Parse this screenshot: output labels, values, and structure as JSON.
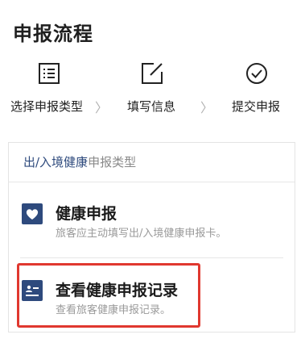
{
  "page": {
    "title": "申报流程"
  },
  "steps": [
    {
      "icon": "list-icon",
      "label": "选择申报类型"
    },
    {
      "icon": "edit-icon",
      "label": "填写信息"
    },
    {
      "icon": "check-circle-icon",
      "label": "提交申报"
    }
  ],
  "step_separator": "〉",
  "card": {
    "header_accent": "出/入境健康",
    "header_rest": "申报类型",
    "items": [
      {
        "icon": "heart-icon",
        "title": "健康申报",
        "description": "旅客应主动填写出/入境健康申报卡。"
      },
      {
        "icon": "record-list-icon",
        "title": "查看健康申报记录",
        "description": "查看旅客健康申报记录。"
      }
    ]
  },
  "colors": {
    "accent": "#2e4a7d",
    "highlight_border": "#e0382f",
    "muted_text": "#9a9a9a"
  }
}
